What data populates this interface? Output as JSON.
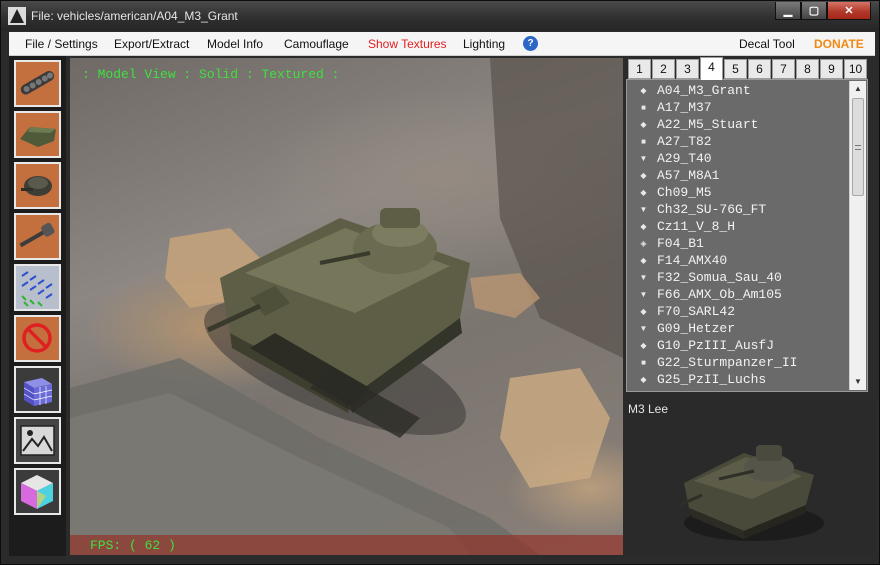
{
  "window": {
    "title": "File: vehicles/american/A04_M3_Grant",
    "controls": [
      "minimize",
      "maximize",
      "close"
    ]
  },
  "menu": {
    "items": [
      {
        "label": "File / Settings"
      },
      {
        "label": "Export/Extract"
      },
      {
        "label": "Model Info"
      },
      {
        "label": "Camouflage"
      },
      {
        "label": "Show Textures",
        "color": "#e21f1f"
      },
      {
        "label": "Lighting"
      }
    ],
    "help_icon": "?",
    "decal_tool": "Decal Tool",
    "donate": "DONATE"
  },
  "toolbar": {
    "tools": [
      {
        "icon": "tracks-icon"
      },
      {
        "icon": "hull-icon"
      },
      {
        "icon": "turret-icon"
      },
      {
        "icon": "gun-icon"
      },
      {
        "icon": "normals-icon"
      },
      {
        "icon": "no-collision-icon"
      },
      {
        "icon": "cube-grid-icon"
      },
      {
        "icon": "image-icon"
      },
      {
        "icon": "color-cube-icon"
      }
    ]
  },
  "viewport": {
    "header": ": Model View : Solid : Textured :",
    "fps_text": "FPS: ( 62 )",
    "fps": 62,
    "overlay_color": "#3fe03f"
  },
  "tier_tabs": {
    "tabs": [
      "1",
      "2",
      "3",
      "4",
      "5",
      "6",
      "7",
      "8",
      "9",
      "10"
    ],
    "active": "4"
  },
  "vehicle_list": {
    "items": [
      {
        "icon": "diamond-small-icon",
        "name": "A04_M3_Grant"
      },
      {
        "icon": "square-icon",
        "name": "A17_M37"
      },
      {
        "icon": "diamond-small-icon",
        "name": "A22_M5_Stuart"
      },
      {
        "icon": "square-icon",
        "name": "A27_T82"
      },
      {
        "icon": "triangle-down-icon",
        "name": "A29_T40"
      },
      {
        "icon": "diamond-icon",
        "name": "A57_M8A1"
      },
      {
        "icon": "diamond-icon",
        "name": "Ch09_M5"
      },
      {
        "icon": "triangle-down-icon",
        "name": "Ch32_SU-76G_FT"
      },
      {
        "icon": "diamond-small-icon",
        "name": "Cz11_V_8_H"
      },
      {
        "icon": "striped-diamond-icon",
        "name": "F04_B1"
      },
      {
        "icon": "diamond-icon",
        "name": "F14_AMX40"
      },
      {
        "icon": "triangle-down-icon",
        "name": "F32_Somua_Sau_40"
      },
      {
        "icon": "triangle-down-icon",
        "name": "F66_AMX_Ob_Am105"
      },
      {
        "icon": "diamond-small-icon",
        "name": "F70_SARL42"
      },
      {
        "icon": "triangle-down-icon",
        "name": "G09_Hetzer"
      },
      {
        "icon": "diamond-small-icon",
        "name": "G10_PzIII_AusfJ"
      },
      {
        "icon": "square-icon",
        "name": "G22_Sturmpanzer_II"
      },
      {
        "icon": "diamond-icon",
        "name": "G25_PzII_Luchs"
      }
    ]
  },
  "preview": {
    "label": "M3 Lee"
  }
}
